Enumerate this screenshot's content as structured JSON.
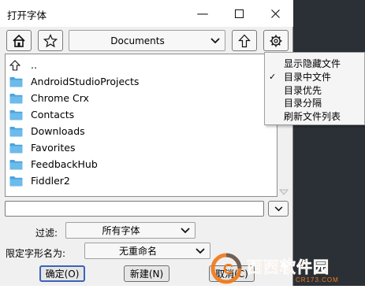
{
  "window": {
    "title": "打开字体",
    "minimize_glyph": "—",
    "maximize_glyph": "☐",
    "close_glyph": "✕"
  },
  "toolbar": {
    "home_icon": "home-icon",
    "favorite_icon": "star-icon",
    "location": "Documents",
    "up_icon": "up-arrow-icon",
    "settings_icon": "gear-icon"
  },
  "file_list": {
    "parent_label": "..",
    "items": [
      "AndroidStudioProjects",
      "Chrome Crx",
      "Contacts",
      "Downloads",
      "Favorites",
      "FeedbackHub",
      "Fiddler2"
    ]
  },
  "settings_menu": {
    "items": [
      {
        "label": "显示隐藏文件",
        "checked": false
      },
      {
        "label": "目录中文件",
        "checked": true
      },
      {
        "label": "目录优先",
        "checked": false
      },
      {
        "label": "目录分隔",
        "checked": false
      },
      {
        "label": "刷新文件列表",
        "checked": false
      }
    ],
    "check_glyph": "✓"
  },
  "filter": {
    "label": "过滤:",
    "value": "所有字体"
  },
  "naming": {
    "label": "限定字形名为:",
    "value": "无重命名"
  },
  "buttons": {
    "ok": "确定(O)",
    "new": "新建(N)",
    "cancel": "取消(C)"
  },
  "watermark": {
    "text": "西西软件园",
    "sub": "CR173.COM"
  },
  "colors": {
    "folder": "#4aa3df",
    "accent": "#3a64b8",
    "watermark_orange": "#f07a1a"
  }
}
